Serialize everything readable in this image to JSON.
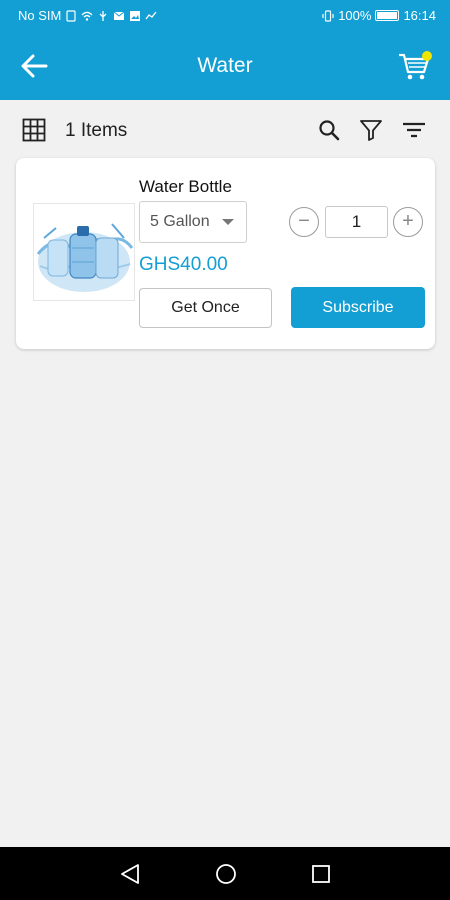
{
  "status_bar": {
    "carrier": "No SIM",
    "battery": "100%",
    "time": "16:14"
  },
  "app_bar": {
    "title": "Water",
    "back_icon": "arrow-left-icon",
    "cart_icon": "shopping-cart-icon",
    "cart_badge_color": "#f2e600"
  },
  "toolbar": {
    "items_count": "1 Items",
    "icons": [
      "grid-view-icon",
      "search-icon",
      "filter-icon",
      "sort-icon"
    ]
  },
  "product": {
    "name": "Water Bottle",
    "variant": "5 Gallon",
    "quantity": "1",
    "price": "GHS40.00",
    "minus": "−",
    "plus": "+",
    "get_once_label": "Get Once",
    "subscribe_label": "Subscribe",
    "image": "water-bottle-image"
  },
  "colors": {
    "primary": "#139fd3",
    "background": "#f1f1f1"
  },
  "nav_bar": {
    "icons": [
      "back-triangle-icon",
      "home-circle-icon",
      "recents-square-icon"
    ]
  }
}
